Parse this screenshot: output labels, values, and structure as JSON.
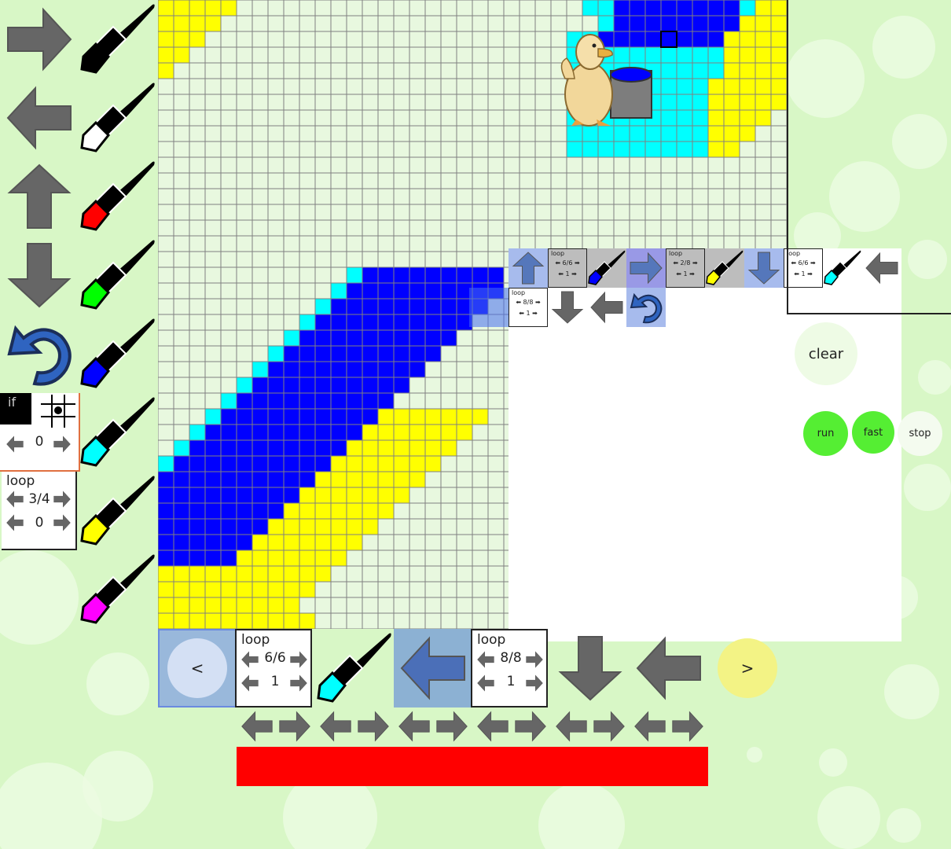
{
  "colors": {
    "background": "#d8f7c6",
    "yellow": "#ffff00",
    "blue": "#0000ff",
    "cyan": "#00ffff",
    "red": "#ff0000",
    "green": "#00ff00",
    "magenta": "#ff00ff",
    "white": "#ffffff",
    "black": "#000000",
    "arrow_grey": "#666666",
    "run_green": "#55ee33",
    "progress_red": "#ff0000"
  },
  "palette": {
    "commands": [
      {
        "name": "right-arrow-icon"
      },
      {
        "name": "left-arrow-icon"
      },
      {
        "name": "up-arrow-icon"
      },
      {
        "name": "down-arrow-icon"
      },
      {
        "name": "undo-curve-icon"
      }
    ],
    "brushes": [
      "#000000",
      "#ffffff",
      "#ff0000",
      "#00ff00",
      "#0000ff",
      "#00ffff",
      "#ffff00",
      "#ff00ff"
    ],
    "if_block": {
      "label": "if",
      "value": "0"
    },
    "loop_block": {
      "label": "loop",
      "count": "3/4",
      "value": "0"
    }
  },
  "editor": {
    "row1": [
      {
        "kind": "up-arrow",
        "selected": true
      },
      {
        "kind": "loop",
        "label": "loop",
        "count": "6/6",
        "value": "1",
        "grey": true
      },
      {
        "kind": "brush",
        "color": "#0000ff",
        "grey": true
      },
      {
        "kind": "right-arrow",
        "selected": true
      },
      {
        "kind": "loop",
        "label": "loop",
        "count": "2/8",
        "value": "1",
        "grey": true
      },
      {
        "kind": "brush",
        "color": "#ffff00",
        "grey": true
      },
      {
        "kind": "down-arrow",
        "selected": true
      },
      {
        "kind": "loop",
        "label": "loop",
        "count": "6/6",
        "value": "1"
      },
      {
        "kind": "brush",
        "color": "#00ffff"
      },
      {
        "kind": "left-arrow"
      }
    ],
    "row2": [
      {
        "kind": "loop",
        "label": "loop",
        "count": "8/8",
        "value": "1"
      },
      {
        "kind": "down-arrow"
      },
      {
        "kind": "left-arrow"
      },
      {
        "kind": "undo",
        "selected": true
      }
    ]
  },
  "strip": {
    "prev_label": "<",
    "next_label": ">",
    "loop1": {
      "label": "loop",
      "count": "6/6",
      "value": "1"
    },
    "loop2": {
      "label": "loop",
      "count": "8/8",
      "value": "1"
    }
  },
  "controls": {
    "clear": "clear",
    "run": "run",
    "fast": "fast",
    "stop": "stop"
  },
  "progress": {
    "fraction": 1.0
  }
}
